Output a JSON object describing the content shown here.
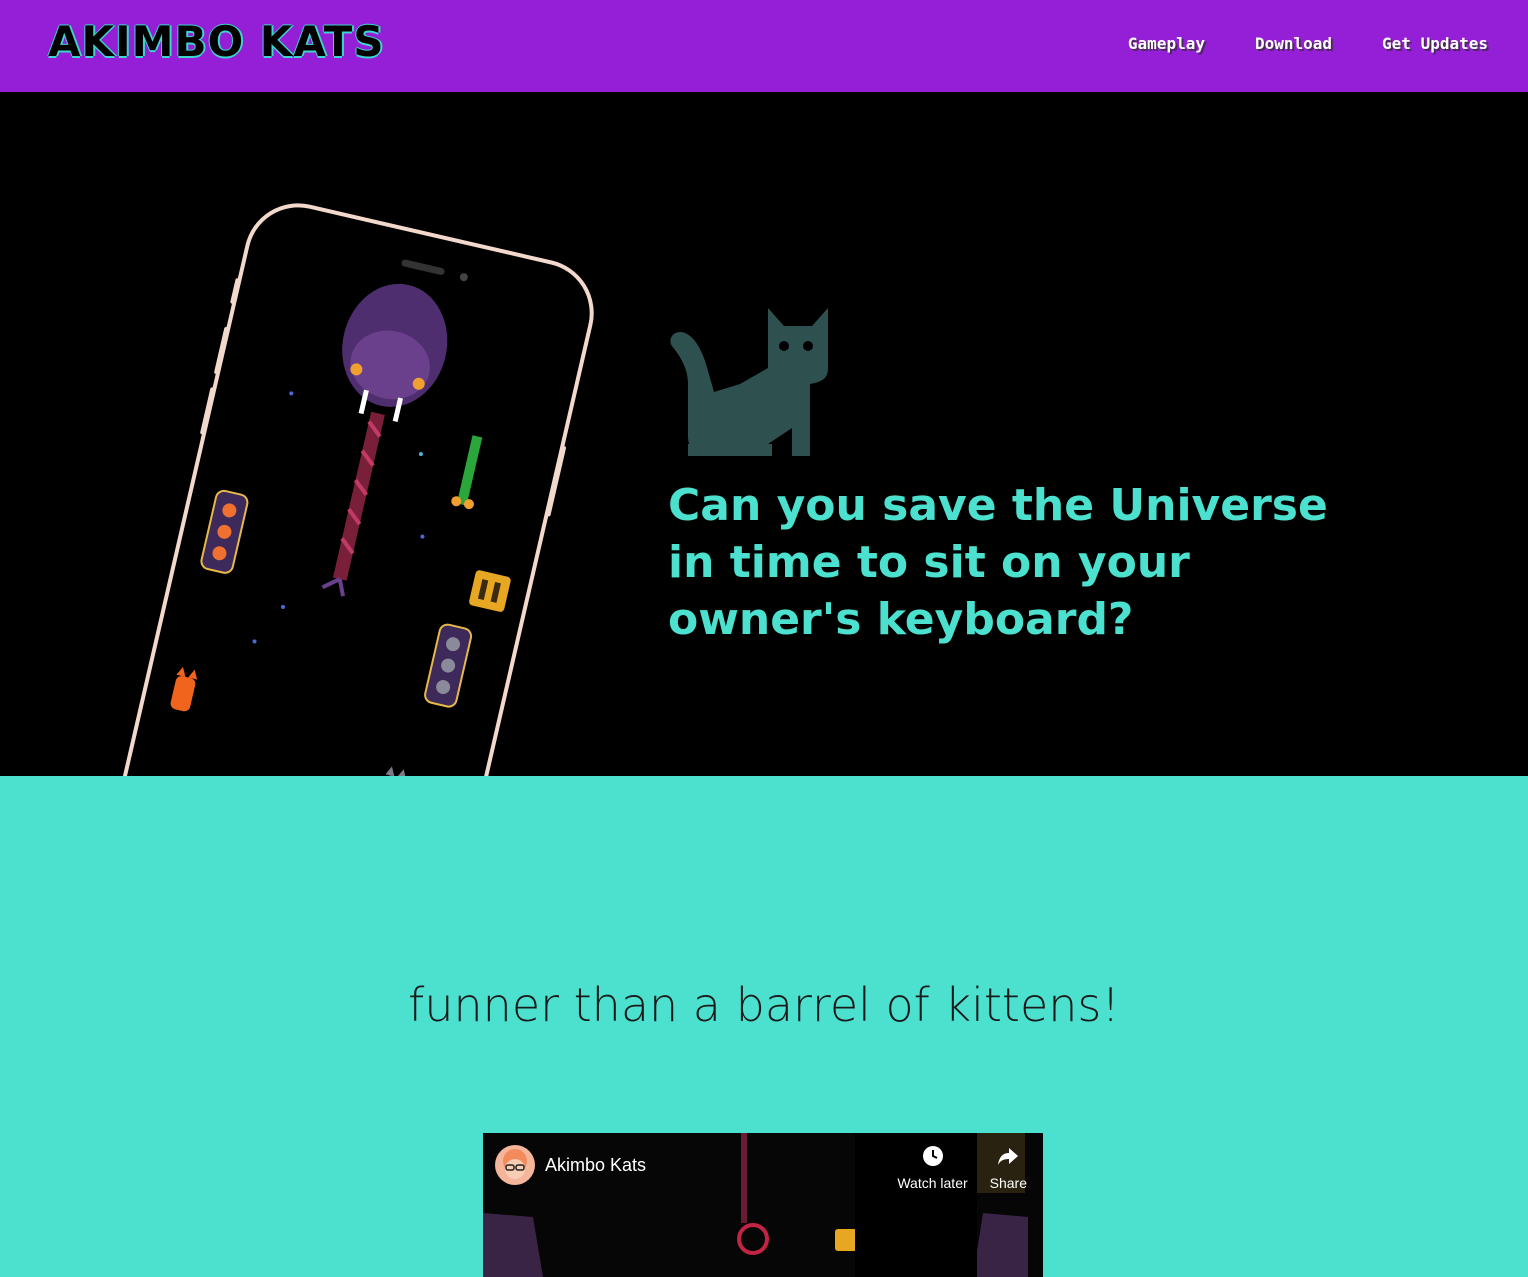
{
  "header": {
    "logo": "AKIMBO KATS",
    "nav": [
      "Gameplay",
      "Download",
      "Get Updates"
    ]
  },
  "hero": {
    "icon": "cat-icon",
    "headline": "Can you save the Universe in time to sit on your owner's keyboard?"
  },
  "tagline": "funner than a barrel of kittens!",
  "video": {
    "title": "Akimbo Kats",
    "actions": {
      "watch_later": "Watch later",
      "share": "Share"
    }
  },
  "colors": {
    "header_bg": "#951fd6",
    "hero_bg": "#000000",
    "accent_teal": "#4ce0cf",
    "cat_icon": "#2e5150"
  }
}
